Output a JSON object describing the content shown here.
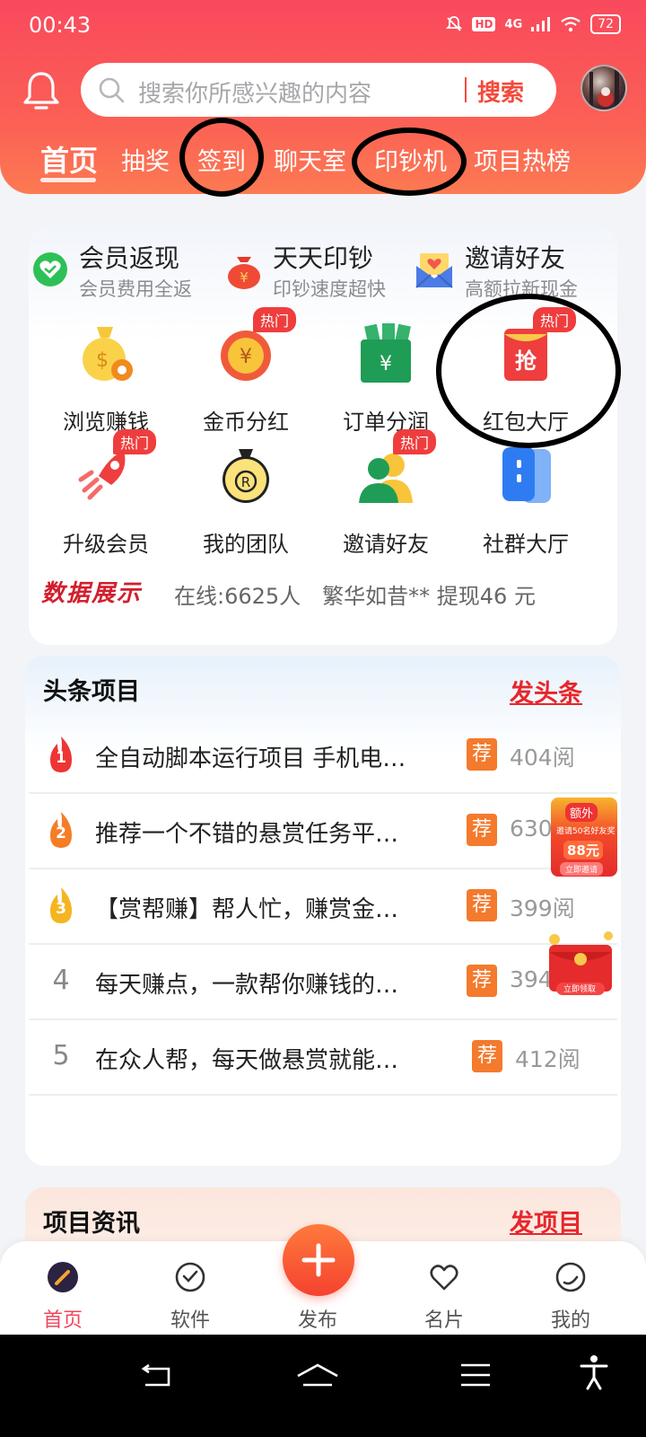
{
  "status_bar": {
    "time": "00:43",
    "network": "4G",
    "hd": "HD",
    "battery": "72"
  },
  "header": {
    "search_placeholder": "搜索你所感兴趣的内容",
    "search_button": "搜索",
    "tabs": [
      {
        "label": "首页",
        "active": true
      },
      {
        "label": "抽奖"
      },
      {
        "label": "签到"
      },
      {
        "label": "聊天室"
      },
      {
        "label": "印钞机"
      },
      {
        "label": "项目热榜"
      }
    ]
  },
  "features": [
    {
      "title": "会员返现",
      "subtitle": "会员费用全返",
      "icon": "heart-check-icon"
    },
    {
      "title": "天天印钞",
      "subtitle": "印钞速度超快",
      "icon": "money-bag-icon"
    },
    {
      "title": "邀请好友",
      "subtitle": "高额拉新现金",
      "icon": "envelope-heart-icon"
    }
  ],
  "grid": [
    {
      "label": "浏览赚钱",
      "icon": "money-bag-gear-icon",
      "hot": false
    },
    {
      "label": "金币分红",
      "icon": "yen-coin-icon",
      "hot": true
    },
    {
      "label": "订单分润",
      "icon": "yen-bag-icon",
      "hot": false
    },
    {
      "label": "红包大厅",
      "icon": "red-envelope-icon",
      "hot": true
    },
    {
      "label": "升级会员",
      "icon": "rocket-icon",
      "hot": true
    },
    {
      "label": "我的团队",
      "icon": "coin-bag-icon",
      "hot": false
    },
    {
      "label": "邀请好友",
      "icon": "users-icon",
      "hot": true
    },
    {
      "label": "社群大厅",
      "icon": "phone-group-icon",
      "hot": false
    }
  ],
  "hot_label": "热门",
  "data_display": {
    "title": "数据展示",
    "text": "在线:6625人　繁华如昔** 提现46 元"
  },
  "headlines": {
    "title": "头条项目",
    "post_button": "发头条",
    "rec_label": "荐",
    "items": [
      {
        "rank": "1",
        "text": "全自动脚本运行项目 手机电…",
        "views": "404阅"
      },
      {
        "rank": "2",
        "text": "推荐一个不错的悬赏任务平…",
        "views": "630"
      },
      {
        "rank": "3",
        "text": "【赏帮赚】帮人忙，赚赏金…",
        "views": "399阅"
      },
      {
        "rank": "4",
        "text": "每天赚点，一款帮你赚钱的…",
        "views": "394"
      },
      {
        "rank": "5",
        "text": "在众人帮，每天做悬赏就能…",
        "views": "412阅"
      }
    ]
  },
  "promo": {
    "badge": "额外",
    "text": "邀请50名好友奖",
    "amount": "88元",
    "button": "立即邀请",
    "button2": "立即领取"
  },
  "project_info": {
    "title": "项目资讯",
    "post_button": "发项目"
  },
  "bottom_nav": [
    {
      "label": "首页",
      "icon": "home-icon",
      "active": true
    },
    {
      "label": "软件",
      "icon": "software-icon"
    },
    {
      "label": "发布",
      "icon": "plus-icon"
    },
    {
      "label": "名片",
      "icon": "heart-icon"
    },
    {
      "label": "我的",
      "icon": "profile-icon"
    }
  ],
  "colors": {
    "brand": "#f9495d",
    "accent": "#f44a3c",
    "hot": "#ef3d3d",
    "rec": "#f47a2d"
  }
}
